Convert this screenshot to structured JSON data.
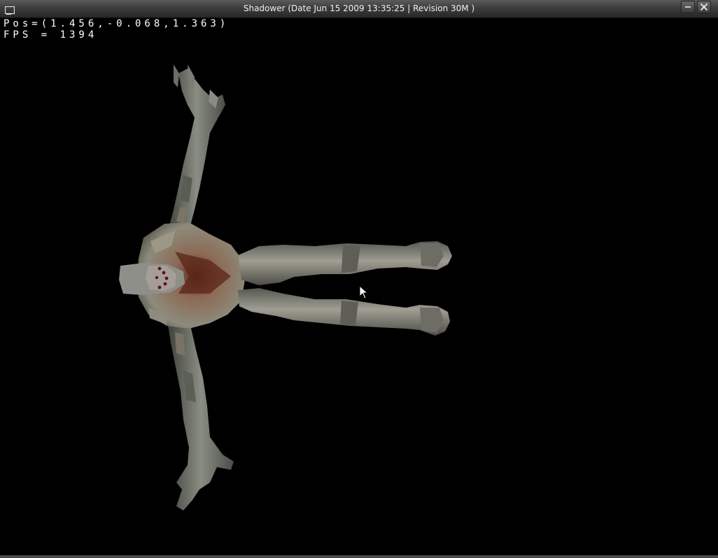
{
  "window": {
    "title": "Shadower  (Date Jun 15 2009 13:35:25 | Revision 30M )",
    "icons": {
      "system": "window-icon",
      "minimize": "minimize-icon",
      "close": "close-icon"
    }
  },
  "hud": {
    "position": "Pos=(1.456,-0.068,1.363)",
    "fps": "FPS = 1394"
  },
  "scene": {
    "background": "#000000",
    "model": "creature-model",
    "cursor": "arrow-cursor"
  }
}
